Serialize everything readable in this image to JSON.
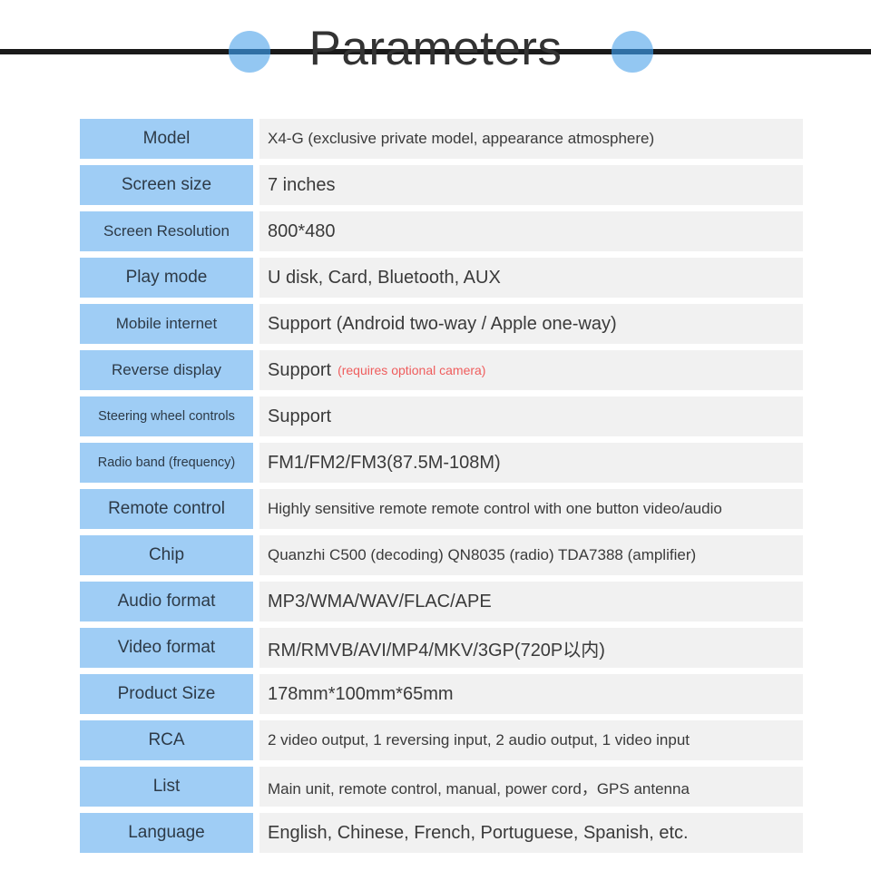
{
  "header": {
    "title": "Parameters",
    "dot_color": "#93c7f2",
    "rule_color": "#1a1a1a"
  },
  "theme": {
    "label_bg": "#9fcdf5",
    "value_bg": "#f1f1f1",
    "text_color": "#333333",
    "note_color": "#ef5d5d"
  },
  "spec_table": {
    "rows": [
      {
        "label": "Model",
        "label_size": "md",
        "value": "X4-G (exclusive private model, appearance atmosphere)",
        "value_size": "sm",
        "note": ""
      },
      {
        "label": "Screen size",
        "label_size": "md",
        "value": "7 inches",
        "value_size": "md",
        "note": ""
      },
      {
        "label": "Screen Resolution",
        "label_size": "sm",
        "value": "800*480",
        "value_size": "md",
        "note": ""
      },
      {
        "label": "Play mode",
        "label_size": "md",
        "value": "U disk, Card, Bluetooth, AUX",
        "value_size": "md",
        "note": ""
      },
      {
        "label": "Mobile internet",
        "label_size": "sm",
        "value": "Support (Android two-way / Apple one-way)",
        "value_size": "md",
        "note": ""
      },
      {
        "label": "Reverse display",
        "label_size": "sm",
        "value": "Support",
        "value_size": "md",
        "note": "(requires optional camera)"
      },
      {
        "label": "Steering wheel controls",
        "label_size": "xs",
        "value": "Support",
        "value_size": "md",
        "note": ""
      },
      {
        "label": "Radio band (frequency)",
        "label_size": "xs",
        "value": "FM1/FM2/FM3(87.5M-108M)",
        "value_size": "md",
        "note": ""
      },
      {
        "label": "Remote control",
        "label_size": "md",
        "value": "Highly sensitive remote remote control with one button video/audio",
        "value_size": "sm",
        "note": ""
      },
      {
        "label": "Chip",
        "label_size": "md",
        "value": "Quanzhi C500 (decoding) QN8035 (radio) TDA7388 (amplifier)",
        "value_size": "sm",
        "note": ""
      },
      {
        "label": "Audio format",
        "label_size": "md",
        "value": "MP3/WMA/WAV/FLAC/APE",
        "value_size": "md",
        "note": ""
      },
      {
        "label": "Video format",
        "label_size": "md",
        "value": "RM/RMVB/AVI/MP4/MKV/3GP(720P以内)",
        "value_size": "md",
        "note": ""
      },
      {
        "label": "Product Size",
        "label_size": "md",
        "value": "178mm*100mm*65mm",
        "value_size": "md",
        "note": ""
      },
      {
        "label": "RCA",
        "label_size": "md",
        "value": "2 video output, 1 reversing input, 2 audio output, 1 video input",
        "value_size": "sm",
        "note": ""
      },
      {
        "label": "List",
        "label_size": "md",
        "value": "Main unit, remote control, manual, power cord，GPS antenna",
        "value_size": "sm",
        "note": ""
      },
      {
        "label": "Language",
        "label_size": "md",
        "value": "English, Chinese, French, Portuguese, Spanish, etc.",
        "value_size": "md",
        "note": ""
      }
    ]
  }
}
